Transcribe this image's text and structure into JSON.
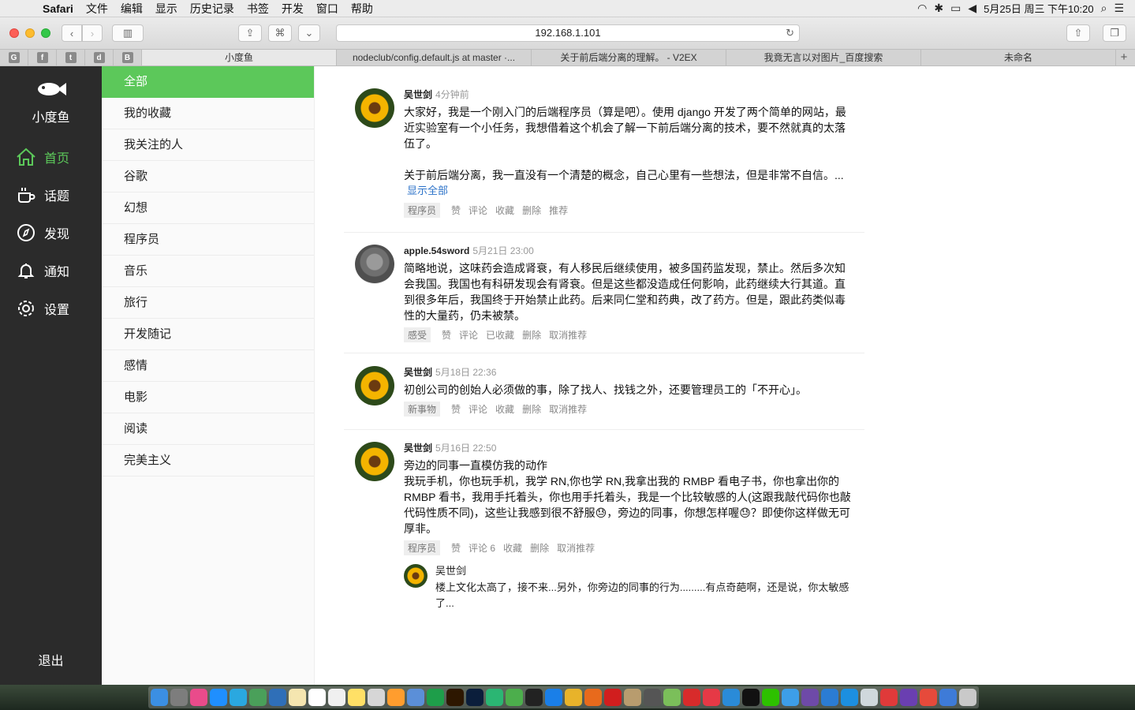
{
  "menubar": {
    "app": "Safari",
    "items": [
      "文件",
      "编辑",
      "显示",
      "历史记录",
      "书签",
      "开发",
      "窗口",
      "帮助"
    ],
    "clock": "5月25日 周三 下午10:20"
  },
  "browser": {
    "url": "192.168.1.101",
    "pinned_tabs": [
      "G",
      "f",
      "t",
      "d",
      "B"
    ],
    "tabs": [
      {
        "title": "小度鱼",
        "active": true
      },
      {
        "title": "nodeclub/config.default.js at master ·..."
      },
      {
        "title": "关于前后端分离的理解。 - V2EX"
      },
      {
        "title": "我竟无言以对图片_百度搜索"
      },
      {
        "title": "未命名"
      }
    ]
  },
  "sidebar": {
    "logo_text": "小度鱼",
    "nav": [
      {
        "label": "首页",
        "icon": "home-icon"
      },
      {
        "label": "话题",
        "icon": "cup-icon"
      },
      {
        "label": "发现",
        "icon": "compass-icon"
      },
      {
        "label": "通知",
        "icon": "bell-icon"
      },
      {
        "label": "设置",
        "icon": "gear-icon"
      }
    ],
    "logout": "退出"
  },
  "categories": [
    "全部",
    "我的收藏",
    "我关注的人",
    "谷歌",
    "幻想",
    "程序员",
    "音乐",
    "旅行",
    "开发随记",
    "感情",
    "电影",
    "阅读",
    "完美主义"
  ],
  "posts": [
    {
      "author": "吴世剑",
      "time": "4分钟前",
      "content": "大家好，我是一个刚入门的后端程序员（算是吧）。使用 django 开发了两个简单的网站，最近实验室有一个小任务，我想借着这个机会了解一下前后端分离的技术，要不然就真的太落伍了。\n\n关于前后端分离，我一直没有一个清楚的概念，自己心里有一些想法，但是非常不自信。...",
      "show_all": "显示全部",
      "tag": "程序员",
      "actions": [
        "赞",
        "评论",
        "收藏",
        "删除",
        "推荐"
      ]
    },
    {
      "author": "apple.54sword",
      "time": "5月21日 23:00",
      "content": "简略地说，这味药会造成肾衰，有人移民后继续使用，被多国药监发现，禁止。然后多次知会我国。我国也有科研发现会有肾衰。但是这些都没造成任何影响，此药继续大行其道。直到很多年后，我国终于开始禁止此药。后来同仁堂和药典，改了药方。但是，跟此药类似毒性的大量药，仍未被禁。",
      "tag": "感受",
      "actions": [
        "赞",
        "评论",
        "已收藏",
        "删除",
        "取消推荐"
      ]
    },
    {
      "author": "吴世剑",
      "time": "5月18日 22:36",
      "content": "初创公司的创始人必须做的事，除了找人、找钱之外，还要管理员工的「不开心」。",
      "tag": "新事物",
      "actions": [
        "赞",
        "评论",
        "收藏",
        "删除",
        "取消推荐"
      ]
    },
    {
      "author": "吴世剑",
      "time": "5月16日 22:50",
      "content": "旁边的同事一直模仿我的动作\n我玩手机，你也玩手机，我学 RN,你也学 RN,我拿出我的 RMBP 看电子书，你也拿出你的 RMBP 看书，我用手托着头，你也用手托着头，我是一个比较敏感的人(这跟我敲代码你也敲代码性质不同)，这些让我感到很不舒服😓，旁边的同事，你想怎样喔😓？即使你这样做无可厚非。",
      "tag": "程序员",
      "actions": [
        "赞",
        "评论 6",
        "收藏",
        "删除",
        "取消推荐"
      ],
      "comment": {
        "author": "吴世剑",
        "text": "楼上文化太高了，接不来...另外，你旁边的同事的行为.........有点奇葩啊，还是说，你太敏感了..."
      }
    }
  ],
  "colors": {
    "accent": "#5cc85a",
    "sidebar_bg": "#2b2b2b",
    "link": "#2d73c9"
  }
}
